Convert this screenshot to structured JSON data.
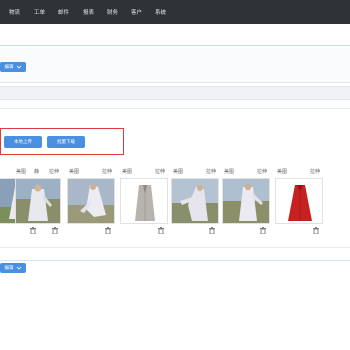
{
  "nav": {
    "items": [
      "物流",
      "工单",
      "邮件",
      "报表",
      "财务",
      "客户",
      "系统"
    ]
  },
  "toolbar": {
    "top_button_label": "编辑",
    "bottom_button_label": "编辑"
  },
  "actions": {
    "upload_label": "本地上传",
    "batch_download_label": "批量下载"
  },
  "gallery": {
    "items": [
      {
        "left_label": "静",
        "right_label": ""
      },
      {
        "left_label": "美图",
        "right_label": "拉伸"
      },
      {
        "left_label": "美图",
        "right_label": "拉伸"
      },
      {
        "left_label": "美图",
        "right_label": "拉伸"
      },
      {
        "left_label": "美图",
        "right_label": "拉伸"
      },
      {
        "left_label": "美图",
        "right_label": "拉伸"
      },
      {
        "left_label": "美图",
        "right_label": "拉伸"
      }
    ]
  },
  "colors": {
    "nav_bg": "#2f3237",
    "accent": "#4a90e2",
    "highlight_border": "#e03b3b"
  },
  "icons": {
    "delete": "trash-icon",
    "dropdown": "chevron-down-icon"
  }
}
